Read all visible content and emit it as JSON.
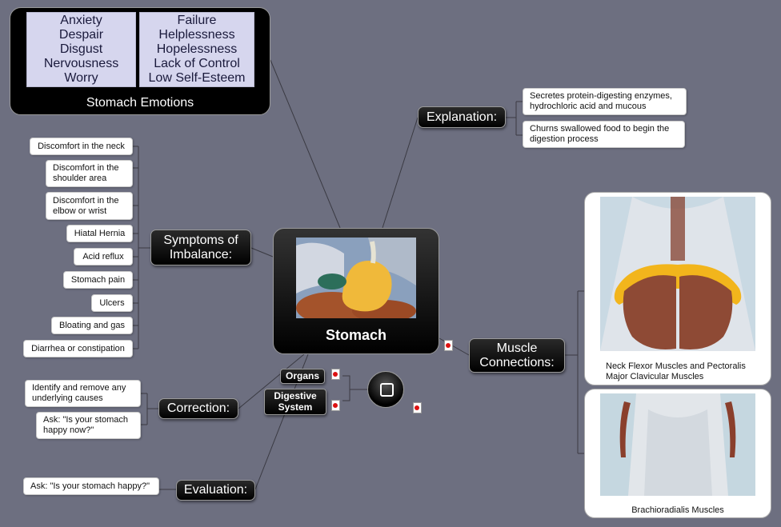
{
  "central": {
    "title": "Stomach"
  },
  "emotions": {
    "col1": [
      "Anxiety",
      "Despair",
      "Disgust",
      "Nervousness",
      "Worry"
    ],
    "col2": [
      "Failure",
      "Helplessness",
      "Hopelessness",
      "Lack of Control",
      "Low Self-Esteem"
    ],
    "title": "Stomach Emotions"
  },
  "explanation": {
    "label": "Explanation:",
    "items": [
      "Secretes protein-digesting enzymes, hydrochloric acid and mucous",
      "Churns swallowed food to begin the digestion process"
    ]
  },
  "symptoms": {
    "label": "Symptoms of Imbalance:",
    "items": [
      "Discomfort in the neck",
      "Discomfort in the shoulder area",
      "Discomfort in the elbow or wrist",
      "Hiatal Hernia",
      "Acid reflux",
      "Stomach pain",
      "Ulcers",
      "Bloating and gas",
      "Diarrhea or constipation"
    ]
  },
  "correction": {
    "label": "Correction:",
    "items": [
      "Identify and remove any underlying causes",
      "Ask: \"Is your stomach happy now?\""
    ]
  },
  "evaluation": {
    "label": "Evaluation:",
    "items": [
      "Ask: \"Is your stomach happy?\""
    ]
  },
  "organs": {
    "label": "Organs"
  },
  "digestive": {
    "label": "Digestive System"
  },
  "muscle": {
    "label": "Muscle Connections:",
    "cards": [
      "Neck Flexor Muscles and Pectoralis Major Clavicular Muscles",
      "Brachioradialis Muscles"
    ]
  },
  "icons": {
    "attachment": "pdf-icon",
    "button": "square-button-icon",
    "center_image": "stomach-anatomy-image",
    "card_image_1": "pectoralis-anatomy-image",
    "card_image_2": "forearm-anatomy-image"
  },
  "colors": {
    "background": "#6d6f80",
    "connector": "#3a3a42",
    "node_dark": "#000000",
    "emotion_box": "#d6d6ee"
  }
}
